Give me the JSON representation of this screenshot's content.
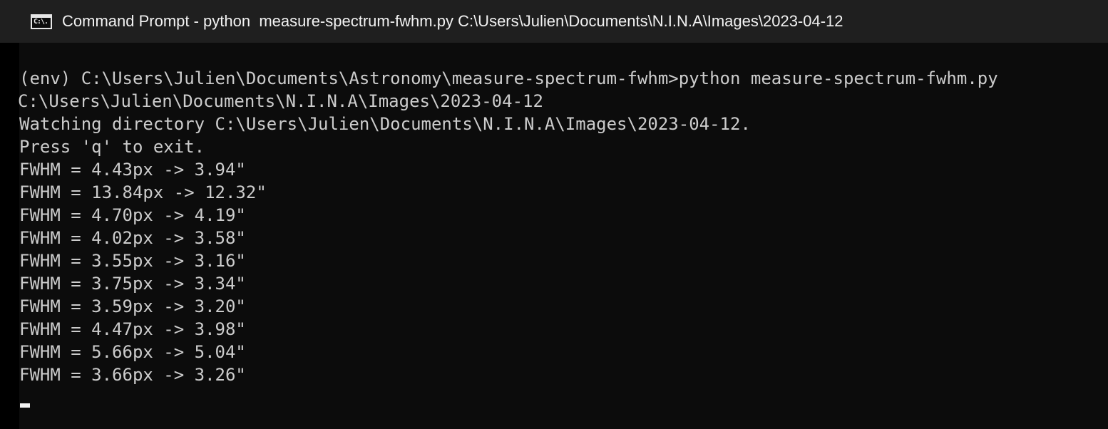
{
  "window": {
    "title": "Command Prompt - python  measure-spectrum-fwhm.py C:\\Users\\Julien\\Documents\\N.I.N.A\\Images\\2023-04-12",
    "icon": "cmd-icon",
    "icon_glyph": "C:\\."
  },
  "console": {
    "lines": [
      "(env) C:\\Users\\Julien\\Documents\\Astronomy\\measure-spectrum-fwhm>python measure-spectrum-fwhm.py",
      "C:\\Users\\Julien\\Documents\\N.I.N.A\\Images\\2023-04-12",
      "Watching directory C:\\Users\\Julien\\Documents\\N.I.N.A\\Images\\2023-04-12.",
      "Press 'q' to exit.",
      "FWHM = 4.43px -> 3.94\"",
      "FWHM = 13.84px -> 12.32\"",
      "FWHM = 4.70px -> 4.19\"",
      "FWHM = 4.02px -> 3.58\"",
      "FWHM = 3.55px -> 3.16\"",
      "FWHM = 3.75px -> 3.34\"",
      "FWHM = 3.59px -> 3.20\"",
      "FWHM = 4.47px -> 3.98\"",
      "FWHM = 5.66px -> 5.04\"",
      "FWHM = 3.66px -> 3.26\""
    ]
  },
  "colors": {
    "title_bar_bg": "#1f1f1f",
    "console_bg": "#0c0c0c",
    "console_text": "#cccccc",
    "title_text": "#f2f2f2"
  }
}
